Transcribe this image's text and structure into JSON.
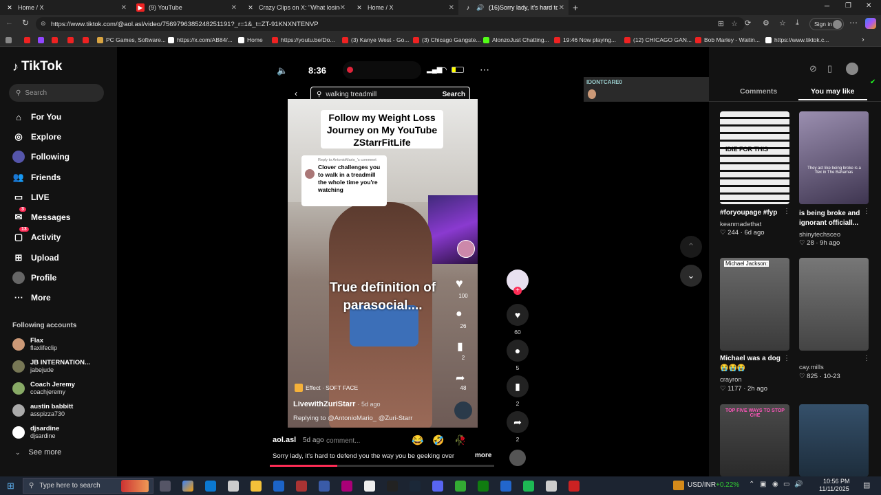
{
  "tabs": [
    {
      "title": "Home / X"
    },
    {
      "title": "(9) YouTube"
    },
    {
      "title": "Crazy Clips on X: \"What losing hu"
    },
    {
      "title": "Home / X"
    },
    {
      "title": "(16)Sorry lady, it's hard to de"
    }
  ],
  "url": "https://www.tiktok.com/@aol.asl/video/7569796385248251191?_r=1&_t=ZT-91KNXNTENVP",
  "signin": "Sign in",
  "bookmarks": [
    "PC Games, Software...",
    "https://x.com/AB84/...",
    "Home",
    "https://youtu.be/Do...",
    "(3) Kanye West - Go...",
    "(3) Chicago Gangste...",
    "AlonzoJust Chatting...",
    "19:46 Now playing...",
    "(12) CHICAGO GAN...",
    "Bob Marley - Waitin...",
    "https://www.tiktok.c..."
  ],
  "logo": "TikTok",
  "search_placeholder": "Search",
  "nav": [
    {
      "label": "For You",
      "icon": "home-icon"
    },
    {
      "label": "Explore",
      "icon": "compass-icon"
    },
    {
      "label": "Following",
      "icon": "following-icon"
    },
    {
      "label": "Friends",
      "icon": "friends-icon"
    },
    {
      "label": "LIVE",
      "icon": "live-icon"
    },
    {
      "label": "Messages",
      "icon": "messages-icon",
      "badge": "3"
    },
    {
      "label": "Activity",
      "icon": "activity-icon",
      "badge": "13"
    },
    {
      "label": "Upload",
      "icon": "upload-icon"
    },
    {
      "label": "Profile",
      "icon": "profile-icon"
    },
    {
      "label": "More",
      "icon": "more-icon"
    }
  ],
  "following_heading": "Following accounts",
  "accounts": [
    {
      "name": "Flax",
      "handle": "flaxlifeclip"
    },
    {
      "name": "JB INTERNATION...",
      "handle": "jabejude"
    },
    {
      "name": "Coach Jeremy",
      "handle": "coachjeremy"
    },
    {
      "name": "austin babbitt",
      "handle": "asspizza730"
    },
    {
      "name": "djsardine",
      "handle": "djsardine"
    }
  ],
  "see_more": "See more",
  "phone": {
    "time": "8:36",
    "search_text": "walking treadmill",
    "search_btn": "Search",
    "caption_top": "Follow my Weight Loss Journey on My YouTube ZStarrFitLife",
    "reply_to": "Reply to AntonioMario_'s comment",
    "reply_text": "Clover challenges you to walk in a treadmill the whole time you're watching",
    "overlay": "True definition of parasocial....",
    "likes": "100",
    "comments": "26",
    "saves": "2",
    "shares": "48",
    "effect": "Effect · SOFT FACE",
    "author": "LivewithZuriStarr",
    "author_time": "5d ago",
    "replying": "Replying to @AntonioMario_ @Zuri-Starr"
  },
  "bottom": {
    "user": "aol.asl",
    "time": "5d ago",
    "comment_placeholder": "comment...",
    "caption": "Sorry lady, it's hard to defend you the way you be geeking over",
    "more": "more"
  },
  "actions": {
    "likes": "60",
    "comments": "5",
    "saves": "2",
    "shares": "2"
  },
  "live_user": "IDONTCARE0",
  "right_tabs": [
    "Comments",
    "You may like"
  ],
  "cards": [
    {
      "title": "#foryoupage #fyp",
      "user": "keanmadethat",
      "stat": "♡ 244 · 6d ago",
      "overlay": "IDIE FOR THIS"
    },
    {
      "title": "is being broke and ignorant officiall...",
      "user": "shinytechsceo",
      "stat": "♡ 28 · 9h ago",
      "overlay": "They act like being broke is a flex in The Bahamas"
    },
    {
      "title": "Michael was a dog",
      "emoji": "😭😭😭",
      "user": "crayron",
      "stat": "♡ 1177 · 2h ago",
      "overlay": "Michael Jackson:"
    },
    {
      "title": "",
      "user": "cay.mills",
      "stat": "♡ 825 · 10-23",
      "overlay": ""
    },
    {
      "title": "",
      "user": "",
      "stat": "",
      "overlay": "TOP FIVE WAYS TO STOP CHE"
    },
    {
      "title": "",
      "user": "",
      "stat": "",
      "overlay": ""
    }
  ],
  "taskbar": {
    "search": "Type here to search",
    "currency": "USD/INR",
    "change": "+0.22%",
    "time": "10:56 PM",
    "date": "11/11/2025"
  },
  "colors": {
    "accent": "#fe2c55",
    "bg": "#000000",
    "sidebar": "#121212"
  }
}
